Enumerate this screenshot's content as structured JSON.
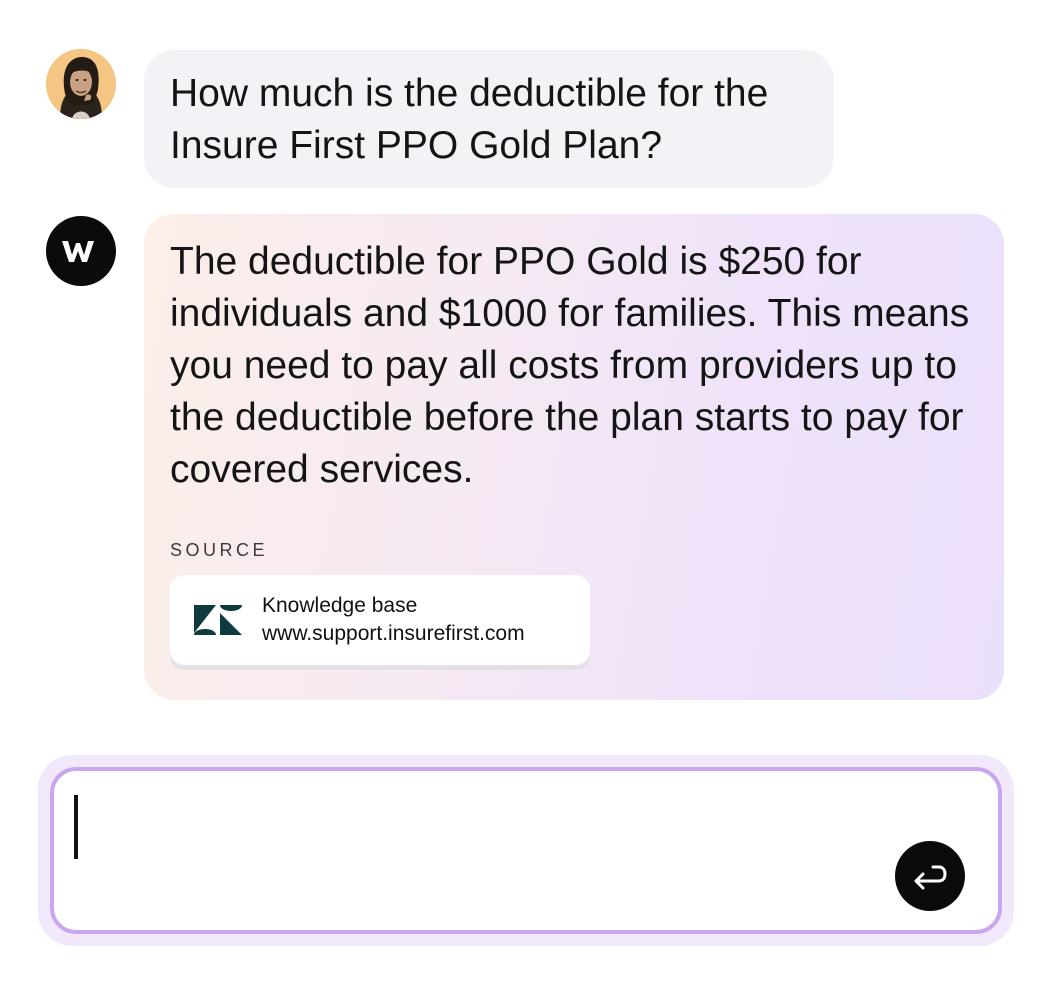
{
  "user_message": {
    "text": "How much is the deductible for the Insure First PPO Gold Plan?",
    "avatar_icon": "user-avatar-photo"
  },
  "assistant_message": {
    "avatar_icon": "w-logo-icon",
    "text": "The deductible for PPO Gold is $250 for individuals and $1000 for families. This means you need to pay all costs from providers up to the deductible before the plan starts to pay for covered services.",
    "source_label": "SOURCE",
    "source": {
      "title": "Knowledge base",
      "url": "www.support.insurefirst.com",
      "icon": "zendesk-logo-icon",
      "icon_color": "#0f3b3f"
    }
  },
  "composer": {
    "value": "",
    "placeholder": "",
    "send_icon": "enter-return-icon",
    "accent": "#c9a6ee"
  }
}
